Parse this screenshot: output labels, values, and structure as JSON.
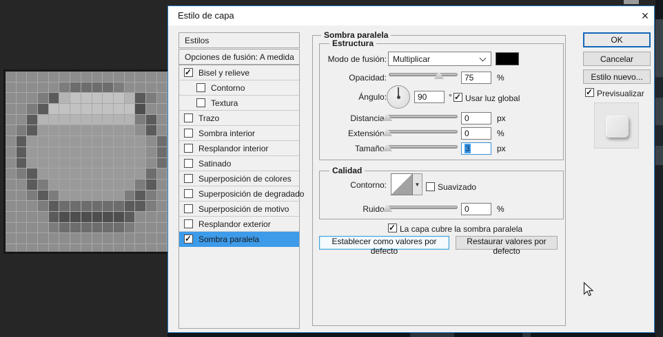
{
  "window": {
    "title": "Estilo de capa",
    "close_icon": "×"
  },
  "styles_panel": {
    "header": "Estilos",
    "blending_options": "Opciones de fusión: A medida",
    "items": [
      {
        "label": "Bisel y relieve",
        "checked": true,
        "indent": false,
        "selected": false
      },
      {
        "label": "Contorno",
        "checked": false,
        "indent": true,
        "selected": false
      },
      {
        "label": "Textura",
        "checked": false,
        "indent": true,
        "selected": false
      },
      {
        "label": "Trazo",
        "checked": false,
        "indent": false,
        "selected": false
      },
      {
        "label": "Sombra interior",
        "checked": false,
        "indent": false,
        "selected": false
      },
      {
        "label": "Resplandor interior",
        "checked": false,
        "indent": false,
        "selected": false
      },
      {
        "label": "Satinado",
        "checked": false,
        "indent": false,
        "selected": false
      },
      {
        "label": "Superposición de colores",
        "checked": false,
        "indent": false,
        "selected": false
      },
      {
        "label": "Superposición de degradado",
        "checked": false,
        "indent": false,
        "selected": false
      },
      {
        "label": "Superposición de motivo",
        "checked": false,
        "indent": false,
        "selected": false
      },
      {
        "label": "Resplandor exterior",
        "checked": false,
        "indent": false,
        "selected": false
      },
      {
        "label": "Sombra paralela",
        "checked": true,
        "indent": false,
        "selected": true
      }
    ]
  },
  "shadow_panel": {
    "group_title": "Sombra paralela",
    "structure": {
      "title": "Estructura",
      "blend_mode_label": "Modo de fusión:",
      "blend_mode_value": "Multiplicar",
      "blend_color": "#000000",
      "opacity_label": "Opacidad:",
      "opacity_value": "75",
      "opacity_unit": "%",
      "opacity_pos": 0.7,
      "angle_label": "Ángulo:",
      "angle_value": "90",
      "angle_unit": "°",
      "use_global_light_label": "Usar luz global",
      "use_global_light_checked": true,
      "distance_label": "Distancia:",
      "distance_value": "0",
      "distance_unit": "px",
      "distance_pos": 0,
      "spread_label": "Extensión:",
      "spread_value": "0",
      "spread_unit": "%",
      "spread_pos": 0,
      "size_label": "Tamaño:",
      "size_value": "3",
      "size_unit": "px",
      "size_pos": 0,
      "size_value_selected": true
    },
    "quality": {
      "title": "Calidad",
      "contour_label": "Contorno:",
      "contour_arrow": "▼",
      "antialias_label": "Suavizado",
      "antialias_checked": false,
      "noise_label": "Ruido:",
      "noise_value": "0",
      "noise_unit": "%",
      "noise_pos": 0
    },
    "knockout_label": "La capa cubre la sombra paralela",
    "knockout_checked": true,
    "set_defaults_button": "Establecer como valores por defecto",
    "reset_defaults_button": "Restaurar valores por defecto"
  },
  "action_panel": {
    "ok": "OK",
    "cancel": "Cancelar",
    "new_style": "Estilo nuevo...",
    "preview_label": "Previsualizar",
    "preview_checked": true
  },
  "colors": {
    "selection_blue": "#3d9bea",
    "dialog_border_blue": "#2779bf",
    "app_background": "#262626"
  },
  "canvas": {
    "cols": 15,
    "cell": 14.7,
    "palette": {
      ".": "#8d8d8d",
      "L": "#9a9a9a",
      "t": "#b4b4b4",
      "l": "#c2c2c2",
      "h": "#7c7c7c",
      "m": "#6d6d6d",
      "d": "#5b5b5b",
      "D": "#4e4e4e"
    },
    "rows": [
      "...............",
      ".....hmmmmh....",
      "...hdtllllltdh.",
      "..hdllllllllD..",
      "..dttttttttthd.",
      ".hdLLLLLLLLL.d.",
      ".dLLLLLLLLLLL.m",
      ".dLLLLLLLLLLL.m",
      ".dLLLLLLLLLLL.m",
      ".hdLLLLLLLLLLm.",
      "..dhLLLLLLLLhd.",
      "..hdhLLLLLLhdh.",
      "...hdmmmmmmddh.",
      "....dDDDDDDd...",
      "....hmmmmmmh...",
      "...............",
      "..............."
    ]
  }
}
